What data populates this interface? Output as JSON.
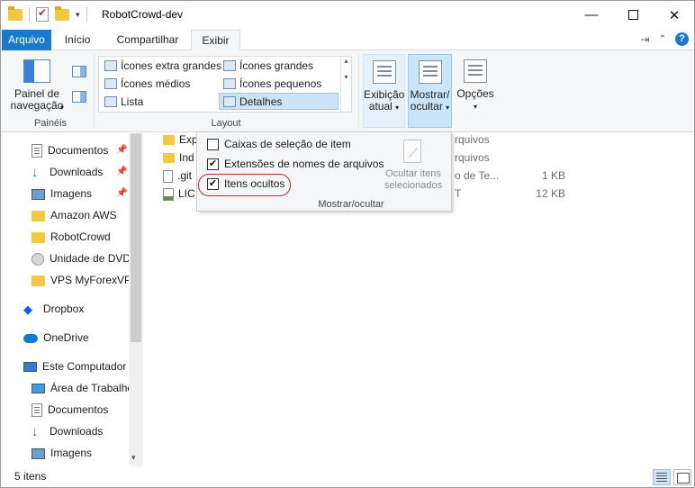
{
  "window": {
    "title": "RobotCrowd-dev",
    "controls": {
      "minimize": "—",
      "close": "✕"
    }
  },
  "tabs": {
    "file": "Arquivo",
    "home": "Início",
    "share": "Compartilhar",
    "view": "Exibir"
  },
  "ribbon": {
    "panes": {
      "nav_pane_label": "Painel de navegação",
      "group": "Painéis"
    },
    "layout": {
      "group": "Layout",
      "items": [
        "Ícones extra grandes",
        "Ícones grandes",
        "Ícones médios",
        "Ícones pequenos",
        "Lista",
        "Detalhes"
      ],
      "selected": "Detalhes"
    },
    "current_view": {
      "line1": "Exibição",
      "line2": "atual"
    },
    "show_hide": {
      "line1": "Mostrar/",
      "line2": "ocultar"
    },
    "options": "Opções"
  },
  "navigation": {
    "items": [
      {
        "label": "Documentos",
        "icon": "document-icon",
        "pinned": true
      },
      {
        "label": "Downloads",
        "icon": "download-icon",
        "pinned": true
      },
      {
        "label": "Imagens",
        "icon": "pictures-icon",
        "pinned": true
      },
      {
        "label": "Amazon AWS",
        "icon": "folder-icon"
      },
      {
        "label": "RobotCrowd",
        "icon": "folder-icon"
      },
      {
        "label": "Unidade de DVD",
        "icon": "dvd-icon"
      },
      {
        "label": "VPS MyForexVPS",
        "icon": "folder-icon"
      },
      {
        "label": "Dropbox",
        "icon": "dropbox-icon"
      },
      {
        "label": "OneDrive",
        "icon": "onedrive-icon"
      },
      {
        "label": "Este Computador",
        "icon": "computer-icon"
      },
      {
        "label": "Área de Trabalho",
        "icon": "desktop-icon"
      },
      {
        "label": "Documentos",
        "icon": "document-icon"
      },
      {
        "label": "Downloads",
        "icon": "download-icon"
      },
      {
        "label": "Imagens",
        "icon": "pictures-icon"
      }
    ]
  },
  "files": [
    {
      "name": "Exp",
      "type": "rquivos",
      "size": ""
    },
    {
      "name": "Ind",
      "type": "rquivos",
      "size": ""
    },
    {
      "name": ".git",
      "type": "o de Te...",
      "size": "1 KB"
    },
    {
      "name": "LIC",
      "type": "T",
      "size": "12 KB"
    }
  ],
  "show_hide_menu": {
    "options": [
      {
        "label": "Caixas de seleção de item",
        "checked": false
      },
      {
        "label": "Extensões de nomes de arquivos",
        "checked": true
      },
      {
        "label": "Itens ocultos",
        "checked": true
      }
    ],
    "hide_selected": {
      "line1": "Ocultar itens",
      "line2": "selecionados"
    },
    "group": "Mostrar/ocultar",
    "check_glyph": "✔"
  },
  "status": {
    "item_count": "5 itens"
  },
  "colors": {
    "accent": "#1979ca",
    "highlight_circle": "#d0202a",
    "folder": "#f4c842"
  }
}
